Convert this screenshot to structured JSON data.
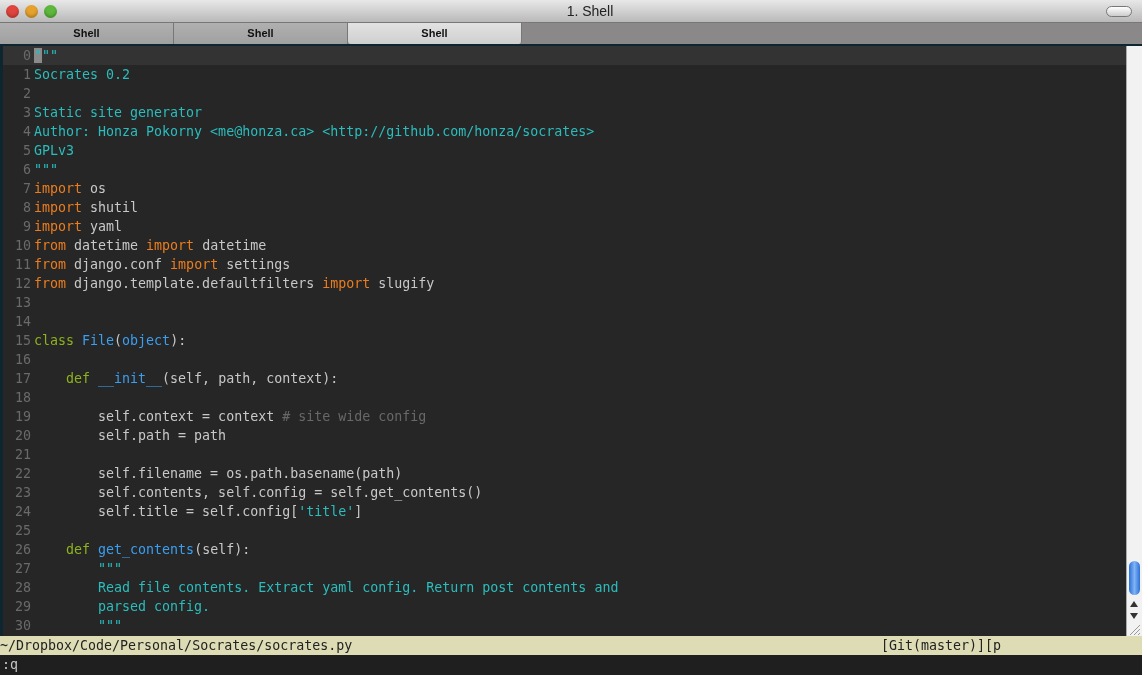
{
  "window": {
    "title": "1. Shell"
  },
  "tabs": [
    {
      "label": "Shell",
      "selected": false
    },
    {
      "label": "Shell",
      "selected": false
    },
    {
      "label": "Shell",
      "selected": true
    }
  ],
  "editor": {
    "lines": [
      {
        "number": "0",
        "current": true,
        "tokens": [
          {
            "kind": "str",
            "text": "\"",
            "cursor": true
          },
          {
            "kind": "str",
            "text": "\"\""
          }
        ]
      },
      {
        "number": "1",
        "current": false,
        "tokens": [
          {
            "kind": "str",
            "text": "Socrates 0.2"
          }
        ]
      },
      {
        "number": "2",
        "current": false
      },
      {
        "number": "3",
        "current": false,
        "tokens": [
          {
            "kind": "str",
            "text": "Static site generator"
          }
        ]
      },
      {
        "number": "4",
        "current": false,
        "tokens": [
          {
            "kind": "str",
            "text": "Author: Honza Pokorny <me@honza.ca> <http://github.com/honza/socrates>"
          }
        ]
      },
      {
        "number": "5",
        "current": false,
        "tokens": [
          {
            "kind": "str",
            "text": "GPLv3"
          }
        ]
      },
      {
        "number": "6",
        "current": false,
        "tokens": [
          {
            "kind": "str",
            "text": "\"\"\""
          }
        ]
      },
      {
        "number": "7",
        "current": false,
        "tokens": [
          {
            "kind": "kw",
            "text": "import"
          },
          {
            "kind": "plain",
            "text": " os"
          }
        ]
      },
      {
        "number": "8",
        "current": false,
        "tokens": [
          {
            "kind": "kw",
            "text": "import"
          },
          {
            "kind": "plain",
            "text": " shutil"
          }
        ]
      },
      {
        "number": "9",
        "current": false,
        "tokens": [
          {
            "kind": "kw",
            "text": "import"
          },
          {
            "kind": "plain",
            "text": " yaml"
          }
        ]
      },
      {
        "number": "10",
        "current": false,
        "tokens": [
          {
            "kind": "kw",
            "text": "from"
          },
          {
            "kind": "plain",
            "text": " datetime "
          },
          {
            "kind": "kw",
            "text": "import"
          },
          {
            "kind": "plain",
            "text": " datetime"
          }
        ]
      },
      {
        "number": "11",
        "current": false,
        "tokens": [
          {
            "kind": "kw",
            "text": "from"
          },
          {
            "kind": "plain",
            "text": " django.conf "
          },
          {
            "kind": "kw",
            "text": "import"
          },
          {
            "kind": "plain",
            "text": " settings"
          }
        ]
      },
      {
        "number": "12",
        "current": false,
        "tokens": [
          {
            "kind": "kw",
            "text": "from"
          },
          {
            "kind": "plain",
            "text": " django.template.defaultfilters "
          },
          {
            "kind": "kw",
            "text": "import"
          },
          {
            "kind": "plain",
            "text": " slugify"
          }
        ]
      },
      {
        "number": "13",
        "current": false
      },
      {
        "number": "14",
        "current": false
      },
      {
        "number": "15",
        "current": false,
        "tokens": [
          {
            "kind": "def",
            "text": "class "
          },
          {
            "kind": "fn",
            "text": "File"
          },
          {
            "kind": "plain",
            "text": "("
          },
          {
            "kind": "fn",
            "text": "object"
          },
          {
            "kind": "plain",
            "text": "):"
          }
        ]
      },
      {
        "number": "16",
        "current": false
      },
      {
        "number": "17",
        "current": false,
        "tokens": [
          {
            "kind": "def",
            "text": "    def "
          },
          {
            "kind": "fn",
            "text": "__init__"
          },
          {
            "kind": "plain",
            "text": "(self, path, context):"
          }
        ]
      },
      {
        "number": "18",
        "current": false
      },
      {
        "number": "19",
        "current": false,
        "tokens": [
          {
            "kind": "plain",
            "text": "        self.context = context "
          },
          {
            "kind": "comment",
            "text": "# site wide config"
          }
        ]
      },
      {
        "number": "20",
        "current": false,
        "tokens": [
          {
            "kind": "plain",
            "text": "        self.path = path"
          }
        ]
      },
      {
        "number": "21",
        "current": false
      },
      {
        "number": "22",
        "current": false,
        "tokens": [
          {
            "kind": "plain",
            "text": "        self.filename = os.path.basename(path)"
          }
        ]
      },
      {
        "number": "23",
        "current": false,
        "tokens": [
          {
            "kind": "plain",
            "text": "        self.contents, self.config = self.get_contents()"
          }
        ]
      },
      {
        "number": "24",
        "current": false,
        "tokens": [
          {
            "kind": "plain",
            "text": "        self.title = self.config["
          },
          {
            "kind": "str",
            "text": "'title'"
          },
          {
            "kind": "plain",
            "text": "]"
          }
        ]
      },
      {
        "number": "25",
        "current": false
      },
      {
        "number": "26",
        "current": false,
        "tokens": [
          {
            "kind": "def",
            "text": "    def "
          },
          {
            "kind": "fn",
            "text": "get_contents"
          },
          {
            "kind": "plain",
            "text": "(self):"
          }
        ]
      },
      {
        "number": "27",
        "current": false,
        "tokens": [
          {
            "kind": "str",
            "text": "        \"\"\""
          }
        ]
      },
      {
        "number": "28",
        "current": false,
        "tokens": [
          {
            "kind": "str",
            "text": "        Read file contents. Extract yaml config. Return post contents and"
          }
        ]
      },
      {
        "number": "29",
        "current": false,
        "tokens": [
          {
            "kind": "str",
            "text": "        parsed config."
          }
        ]
      },
      {
        "number": "30",
        "current": false,
        "tokens": [
          {
            "kind": "str",
            "text": "        \"\"\""
          }
        ]
      }
    ]
  },
  "status_line": {
    "path": "~/Dropbox/Code/Personal/Socrates/socrates.py",
    "info": "[Git(master)][p"
  },
  "command_line": ":q"
}
